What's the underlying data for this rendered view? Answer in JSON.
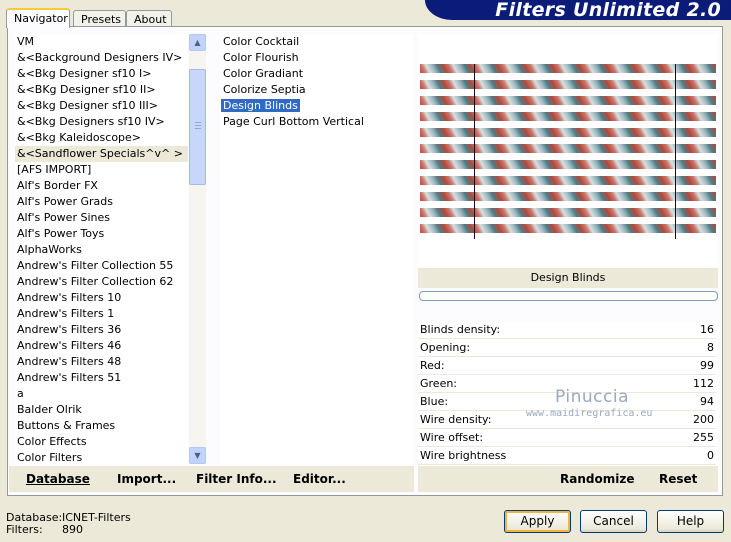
{
  "app": {
    "title": "Filters Unlimited 2.0"
  },
  "tabs": [
    {
      "label": "Navigator",
      "active": true
    },
    {
      "label": "Presets",
      "active": false
    },
    {
      "label": "About",
      "active": false
    }
  ],
  "categories": {
    "items": [
      "VM",
      "&<Background Designers IV>",
      "&<Bkg Designer sf10 I>",
      "&<BKg Designer sf10 II>",
      "&<Bkg Designer sf10 III>",
      "&<Bkg Designers sf10 IV>",
      "&<Bkg Kaleidoscope>",
      "&<Sandflower Specials^v^ >",
      "[AFS IMPORT]",
      "Alf's Border FX",
      "Alf's Power Grads",
      "Alf's Power Sines",
      "Alf's Power Toys",
      "AlphaWorks",
      "Andrew's Filter Collection 55",
      "Andrew's Filter Collection 62",
      "Andrew's Filters 10",
      "Andrew's Filters 1",
      "Andrew's Filters 36",
      "Andrew's Filters 46",
      "Andrew's Filters 48",
      "Andrew's Filters 51",
      "a",
      "Balder Olrik",
      "Buttons & Frames",
      "Color Effects",
      "Color Filters"
    ],
    "selected": "&<Sandflower Specials^v^ >"
  },
  "filters": {
    "items": [
      "Color Cocktail",
      "Color Flourish",
      "Color Gradiant",
      "Colorize Septia",
      "Design Blinds",
      "Page Curl Bottom Vertical"
    ],
    "selected": "Design Blinds"
  },
  "bottom_left": {
    "database": "Database",
    "import": "Import...",
    "filter_info": "Filter Info...",
    "editor": "Editor..."
  },
  "preview": {
    "filter_name": "Design Blinds",
    "progress": 0
  },
  "params": [
    {
      "label": "Blinds density:",
      "value": "16"
    },
    {
      "label": "Opening:",
      "value": "8"
    },
    {
      "label": "Red:",
      "value": "99"
    },
    {
      "label": "Green:",
      "value": "112"
    },
    {
      "label": "Blue:",
      "value": "94"
    },
    {
      "label": "Wire density:",
      "value": "200"
    },
    {
      "label": "Wire offset:",
      "value": "255"
    },
    {
      "label": "Wire brightness",
      "value": "0"
    }
  ],
  "bottom_right": {
    "randomize": "Randomize",
    "reset": "Reset"
  },
  "watermark": {
    "line1": "Pinuccia",
    "line2": "www.maidiregrafica.eu"
  },
  "info": {
    "database_label": "Database:",
    "database_value": "ICNET-Filters",
    "filters_label": "Filters:",
    "filters_value": "890"
  },
  "buttons": {
    "apply": "Apply",
    "cancel": "Cancel",
    "help": "Help"
  },
  "colors": {
    "banner": "#0a1b7a",
    "selection": "#316ac5",
    "default_button_focus": "#f8b33a"
  }
}
